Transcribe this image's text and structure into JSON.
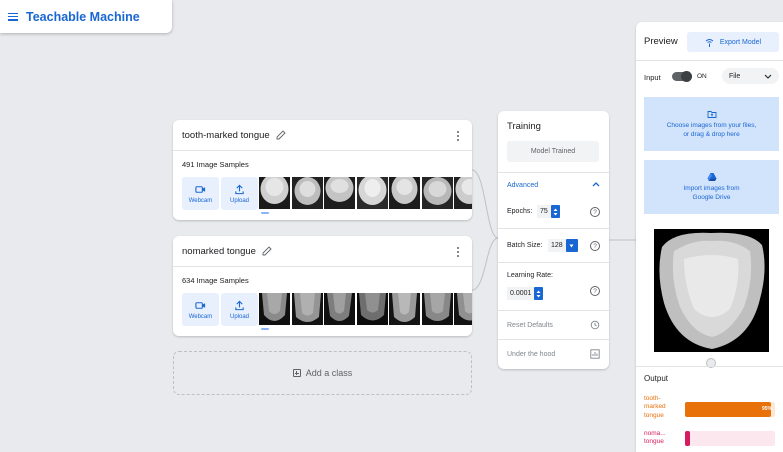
{
  "app": {
    "title": "Teachable Machine"
  },
  "classes": [
    {
      "name": "tooth-marked tongue",
      "samples": "491 Image Samples",
      "webcam_label": "Webcam",
      "upload_label": "Upload"
    },
    {
      "name": "nomarked tongue",
      "samples": "634 Image Samples",
      "webcam_label": "Webcam",
      "upload_label": "Upload"
    }
  ],
  "add_class": {
    "label": "Add a class"
  },
  "training": {
    "title": "Training",
    "train_button": "Model Trained",
    "advanced_label": "Advanced",
    "epochs_label": "Epochs:",
    "epochs_value": "75",
    "batch_label": "Batch Size:",
    "batch_value": "128",
    "lr_label": "Learning Rate:",
    "lr_value": "0.0001",
    "reset_label": "Reset Defaults",
    "hood_label": "Under the hood"
  },
  "preview": {
    "title": "Preview",
    "export_label": "Export Model",
    "input_label": "Input",
    "toggle_state": "ON",
    "source_select": "File",
    "choose_line1": "Choose images from your files,",
    "choose_line2": "or drag & drop here",
    "import_line1": "Import images from",
    "import_line2": "Google Drive",
    "output_title": "Output",
    "outputs": [
      {
        "line1": "tooth-",
        "line2": "marked",
        "line3": "tongue",
        "percent_label": "95%",
        "fraction": 0.95,
        "color": "#e8710a",
        "bg": "#fde8d4"
      },
      {
        "line1": "noma...",
        "line2": "tongue",
        "line3": "",
        "percent_label": "",
        "fraction": 0.05,
        "color": "#d81b60",
        "bg": "#fde7ef"
      }
    ]
  },
  "colors": {
    "accent": "#1967d2",
    "accent_light": "#e8f0fe",
    "background": "#e8eaed"
  }
}
